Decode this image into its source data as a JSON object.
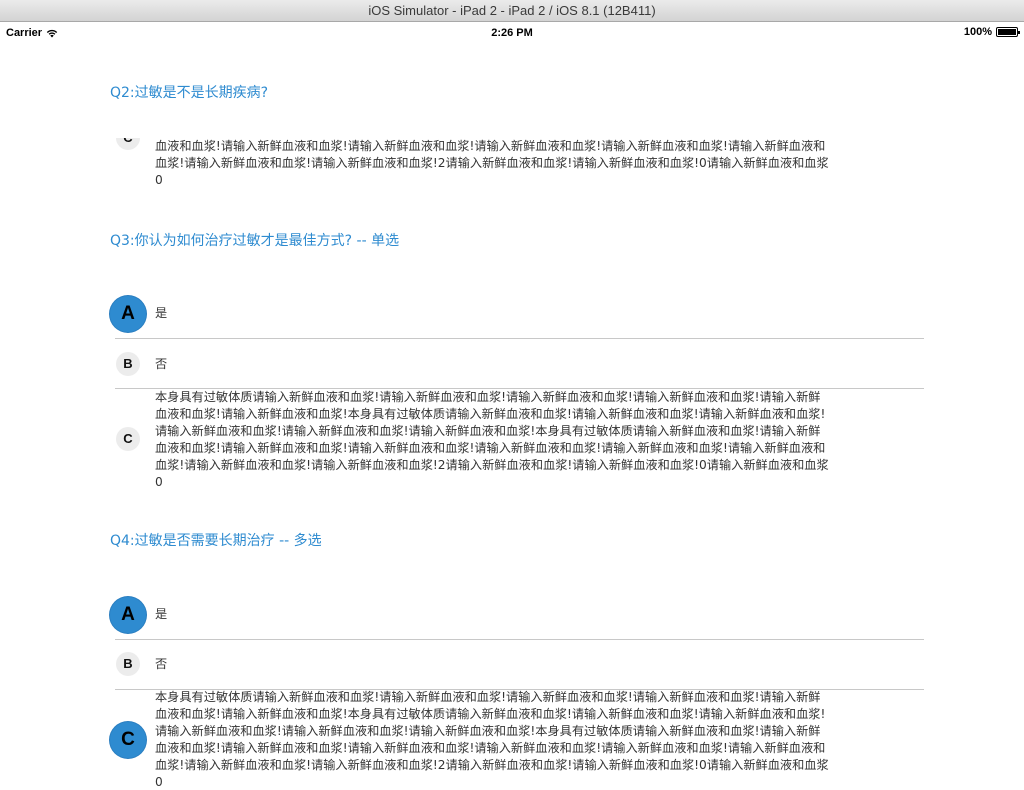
{
  "window": {
    "title": "iOS Simulator - iPad 2 - iPad 2 / iOS 8.1 (12B411)"
  },
  "status_bar": {
    "carrier": "Carrier",
    "time": "2:26 PM",
    "battery": "100%"
  },
  "q2": {
    "question": "Q2:过敏是不是长期疾病?",
    "partial_option": {
      "letter": "C",
      "lines": [
        "血液和血浆!请输入新鲜血液和血浆!请输入新鲜血液和血浆!请输入新鲜血液和血浆!请输入新鲜血液和血浆!请输入新鲜血液和",
        "血浆!请输入新鲜血液和血浆!请输入新鲜血液和血浆!2请输入新鲜血液和血浆!请输入新鲜血液和血浆!0请输入新鲜血液和血浆",
        "0"
      ]
    }
  },
  "q3": {
    "question": "Q3:你认为如何治疗过敏才是最佳方式? -- 单选",
    "options": [
      {
        "letter": "A",
        "text": "是",
        "selected": true
      },
      {
        "letter": "B",
        "text": "否",
        "selected": false
      },
      {
        "letter": "C",
        "selected": false,
        "lines": [
          "本身具有过敏体质请输入新鲜血液和血浆!请输入新鲜血液和血浆!请输入新鲜血液和血浆!请输入新鲜血液和血浆!请输入新鲜",
          "血液和血浆!请输入新鲜血液和血浆!本身具有过敏体质请输入新鲜血液和血浆!请输入新鲜血液和血浆!请输入新鲜血液和血浆!",
          "请输入新鲜血液和血浆!请输入新鲜血液和血浆!请输入新鲜血液和血浆!本身具有过敏体质请输入新鲜血液和血浆!请输入新鲜",
          "血液和血浆!请输入新鲜血液和血浆!请输入新鲜血液和血浆!请输入新鲜血液和血浆!请输入新鲜血液和血浆!请输入新鲜血液和",
          "血浆!请输入新鲜血液和血浆!请输入新鲜血液和血浆!2请输入新鲜血液和血浆!请输入新鲜血液和血浆!0请输入新鲜血液和血浆",
          "0"
        ]
      }
    ]
  },
  "q4": {
    "question": "Q4:过敏是否需要长期治疗 -- 多选",
    "options": [
      {
        "letter": "A",
        "text": "是",
        "selected": true
      },
      {
        "letter": "B",
        "text": "否",
        "selected": false
      },
      {
        "letter": "C",
        "selected": true,
        "lines": [
          "本身具有过敏体质请输入新鲜血液和血浆!请输入新鲜血液和血浆!请输入新鲜血液和血浆!请输入新鲜血液和血浆!请输入新鲜",
          "血液和血浆!请输入新鲜血液和血浆!本身具有过敏体质请输入新鲜血液和血浆!请输入新鲜血液和血浆!请输入新鲜血液和血浆!",
          "请输入新鲜血液和血浆!请输入新鲜血液和血浆!请输入新鲜血液和血浆!本身具有过敏体质请输入新鲜血液和血浆!请输入新鲜",
          "血液和血浆!请输入新鲜血液和血浆!请输入新鲜血液和血浆!请输入新鲜血液和血浆!请输入新鲜血液和血浆!请输入新鲜血液和",
          "血浆!请输入新鲜血液和血浆!请输入新鲜血液和血浆!2请输入新鲜血液和血浆!请输入新鲜血液和血浆!0请输入新鲜血液和血浆",
          "0"
        ]
      }
    ]
  },
  "colors": {
    "accent": "#2e8bd0",
    "badge_gray": "#ececec",
    "divider": "#c8c8c8"
  }
}
